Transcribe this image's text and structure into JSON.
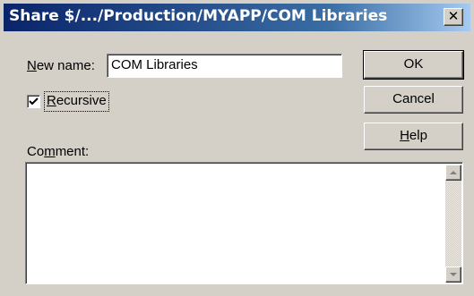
{
  "dialog": {
    "title": "Share $/.../Production/MYAPP/COM Libraries",
    "close_label": "✕"
  },
  "form": {
    "new_name_label_pre": "N",
    "new_name_label_post": "ew name:",
    "new_name_value": "COM Libraries",
    "recursive_label_pre": "R",
    "recursive_label_post": "ecursive",
    "recursive_checked": true,
    "comment_label_pre": "Co",
    "comment_label_accel": "m",
    "comment_label_post": "ment:",
    "comment_value": ""
  },
  "buttons": {
    "ok_label": "OK",
    "cancel_label": "Cancel",
    "help_label_accel": "H",
    "help_label_post": "elp"
  },
  "icons": {
    "checkbox": "checkmark-icon",
    "scroll_up": "triangle-up-icon",
    "scroll_down": "triangle-down-icon"
  }
}
